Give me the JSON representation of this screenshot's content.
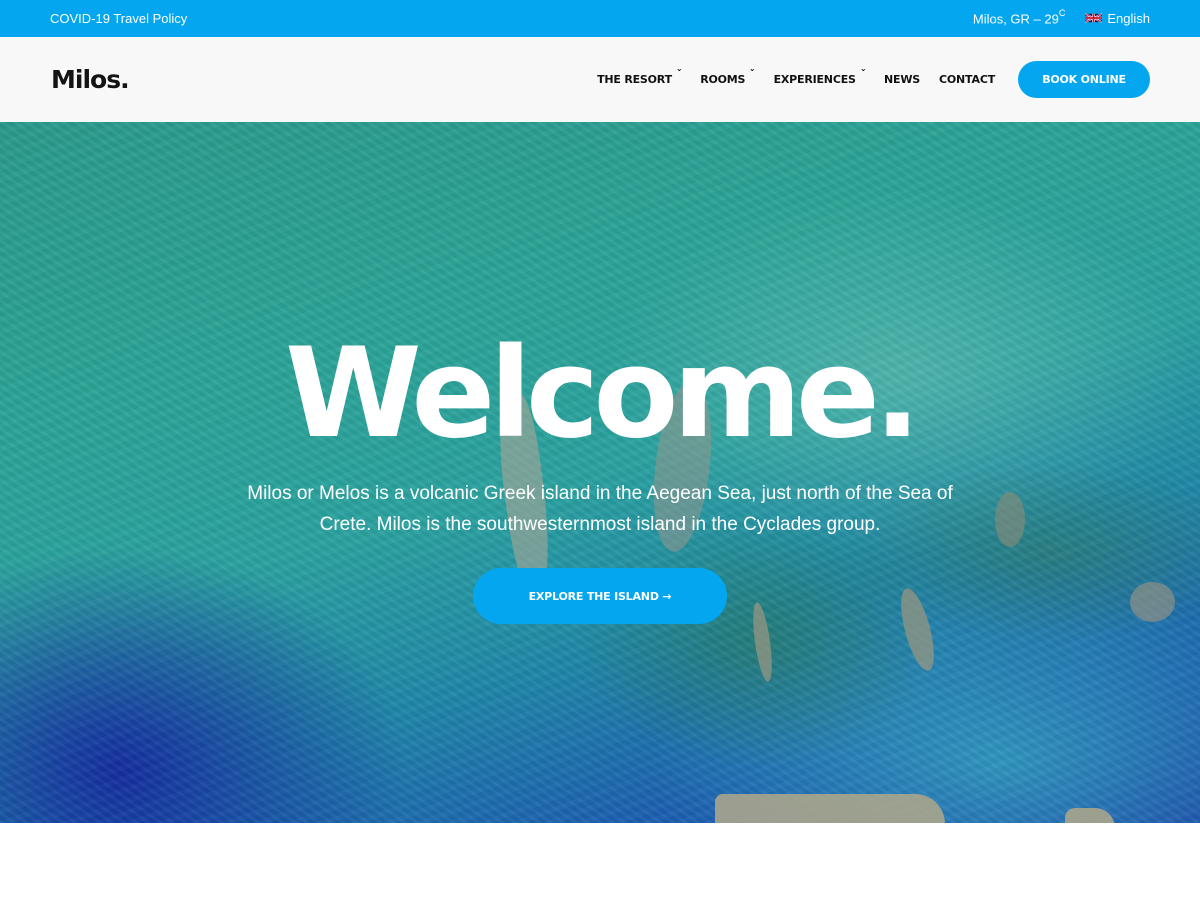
{
  "topbar": {
    "policy_link": "COVID-19 Travel Policy",
    "weather_location": "Milos, GR – 29",
    "weather_unit": "C",
    "language": "English",
    "language_flag_icon": "uk-flag-icon"
  },
  "header": {
    "logo": "Milos.",
    "nav": [
      {
        "label": "THE RESORT",
        "has_dropdown": true
      },
      {
        "label": "ROOMS",
        "has_dropdown": true
      },
      {
        "label": "EXPERIENCES",
        "has_dropdown": true
      },
      {
        "label": "NEWS",
        "has_dropdown": false
      },
      {
        "label": "CONTACT",
        "has_dropdown": false
      }
    ],
    "dropdown_glyph": "˅",
    "book_button": "BOOK ONLINE"
  },
  "hero": {
    "title": "Welcome.",
    "description": "Milos or Melos is a volcanic Greek island in the Aegean Sea, just north of the Sea of Crete. Milos is the southwesternmost island in the Cyclades group.",
    "cta_button": "EXPLORE THE ISLAND →",
    "background": "aerial satellite image of turquoise sea and islands"
  },
  "colors": {
    "accent": "#03a6ef",
    "header_bg": "#f8f8f8",
    "text_dark": "#111111",
    "white": "#ffffff"
  }
}
